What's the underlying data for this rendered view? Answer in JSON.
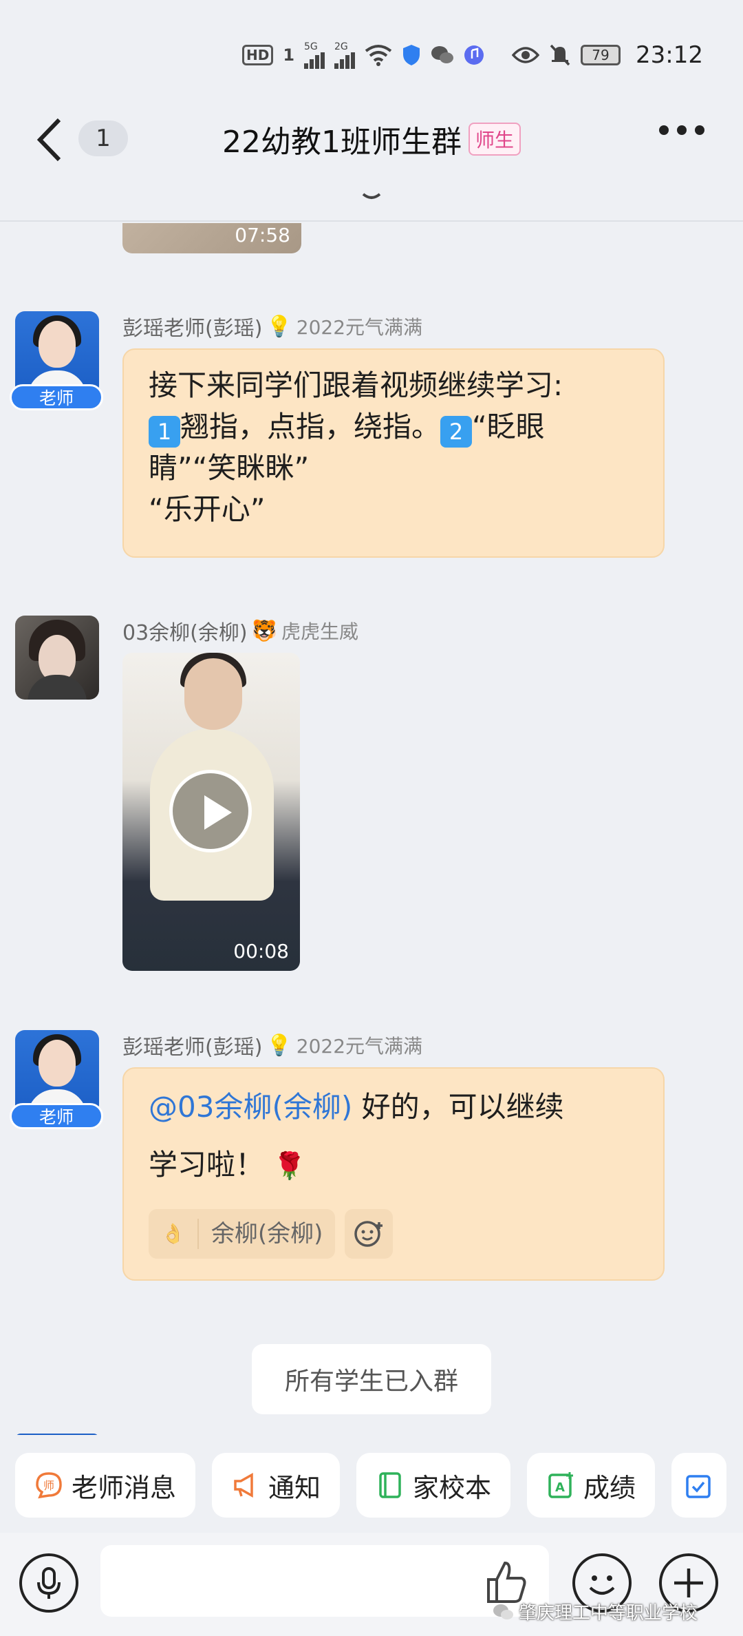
{
  "status_bar": {
    "hd": "HD",
    "sim1": "1",
    "net1": "5G",
    "net2": "2G",
    "battery": "79",
    "time": "23:12"
  },
  "header": {
    "unread_count": "1",
    "title": "22幼教1班师生群",
    "tag": "师生"
  },
  "chat": {
    "prev_video_duration": "07:58",
    "messages": [
      {
        "sender": "彭瑶老师(彭瑶)",
        "medal_icon": "💡",
        "medal_text": "2022元气满满",
        "role": "老师",
        "line1": "接下来同学们跟着视频继续学习:",
        "k1": "1",
        "line2a": "翘指，点指，绕指。",
        "k2": "2",
        "line2b": "“眨眼",
        "line3": "睛”“笑眯眯”",
        "line4": "“乐开心”"
      },
      {
        "sender": "03余柳(余柳)",
        "medal_icon": "🐯",
        "medal_text": "虎虎生威",
        "video_duration": "00:08"
      },
      {
        "sender": "彭瑶老师(彭瑶)",
        "medal_icon": "💡",
        "medal_text": "2022元气满满",
        "role": "老师",
        "mention": "@03余柳(余柳)",
        "text1": " 好的，可以继续",
        "text2": "学习啦！",
        "emoji": "🌹",
        "reaction_emoji": "👌",
        "reaction_user": "余柳(余柳)"
      }
    ],
    "system_notice": "所有学生已入群"
  },
  "shortcuts": [
    {
      "label": "老师消息",
      "icon": "teacher-message-icon",
      "color": "#f07a3a"
    },
    {
      "label": "通知",
      "icon": "megaphone-icon",
      "color": "#f07a3a"
    },
    {
      "label": "家校本",
      "icon": "notebook-icon",
      "color": "#2fb25a"
    },
    {
      "label": "成绩",
      "icon": "grade-icon",
      "color": "#2fb25a"
    }
  ],
  "input": {
    "placeholder": ""
  },
  "watermark": "肇庆理工中等职业学校"
}
